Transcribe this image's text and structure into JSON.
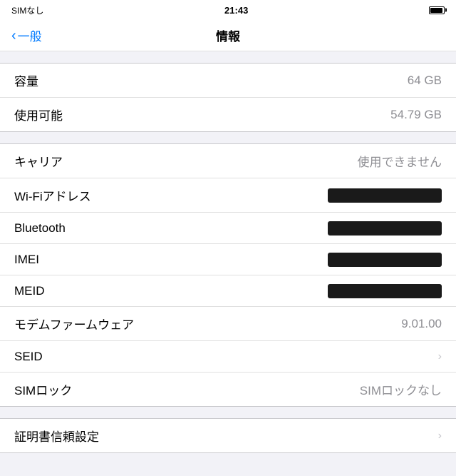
{
  "statusBar": {
    "left": "SIMなし ✦",
    "time": "21:43",
    "carrier": "SIMなし"
  },
  "navBar": {
    "backLabel": "一般",
    "title": "情報"
  },
  "section1": {
    "rows": [
      {
        "label": "容量",
        "value": "64 GB",
        "type": "text"
      },
      {
        "label": "使用可能",
        "value": "54.79 GB",
        "type": "text"
      }
    ]
  },
  "section2": {
    "rows": [
      {
        "label": "キャリア",
        "value": "使用できません",
        "type": "text"
      },
      {
        "label": "Wi-Fiアドレス",
        "value": "",
        "type": "redacted"
      },
      {
        "label": "Bluetooth",
        "value": "",
        "type": "redacted"
      },
      {
        "label": "IMEI",
        "value": "",
        "type": "redacted"
      },
      {
        "label": "MEID",
        "value": "",
        "type": "redacted"
      },
      {
        "label": "モデムファームウェア",
        "value": "9.01.00",
        "type": "text"
      },
      {
        "label": "SEID",
        "value": "",
        "type": "chevron"
      },
      {
        "label": "SIMロック",
        "value": "SIMロックなし",
        "type": "text"
      }
    ]
  },
  "section3": {
    "rows": [
      {
        "label": "証明書信頼設定",
        "value": "",
        "type": "chevron"
      }
    ]
  },
  "icons": {
    "chevron": "›",
    "back_chevron": "‹"
  }
}
